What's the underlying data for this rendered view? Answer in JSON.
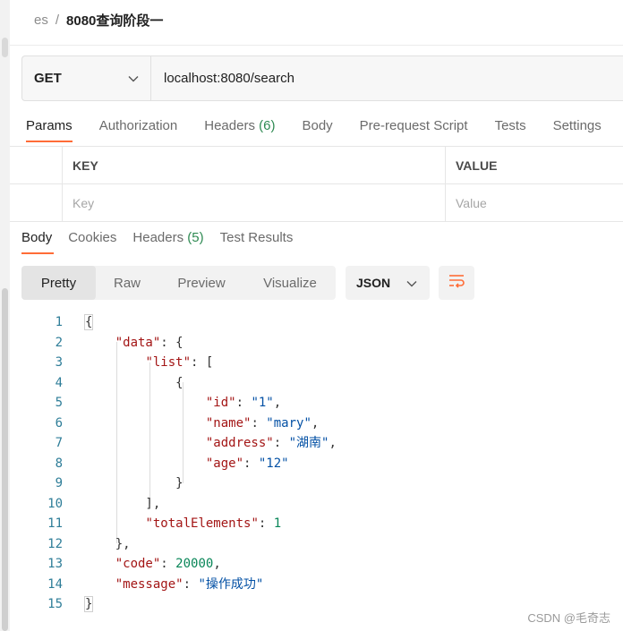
{
  "breadcrumb": {
    "parent": "es",
    "separator": "/",
    "current": "8080查询阶段一"
  },
  "request": {
    "method": "GET",
    "url": "localhost:8080/search"
  },
  "request_tabs": [
    {
      "label": "Params",
      "count": ""
    },
    {
      "label": "Authorization",
      "count": ""
    },
    {
      "label": "Headers",
      "count": "(6)"
    },
    {
      "label": "Body",
      "count": ""
    },
    {
      "label": "Pre-request Script",
      "count": ""
    },
    {
      "label": "Tests",
      "count": ""
    },
    {
      "label": "Settings",
      "count": ""
    }
  ],
  "params_table": {
    "headers": {
      "key": "KEY",
      "value": "VALUE"
    },
    "placeholders": {
      "key": "Key",
      "value": "Value"
    }
  },
  "response_tabs": [
    {
      "label": "Body",
      "count": ""
    },
    {
      "label": "Cookies",
      "count": ""
    },
    {
      "label": "Headers",
      "count": "(5)"
    },
    {
      "label": "Test Results",
      "count": ""
    }
  ],
  "view_modes": [
    "Pretty",
    "Raw",
    "Preview",
    "Visualize"
  ],
  "format": "JSON",
  "icons": {
    "dropdown": "chevron-down-icon",
    "wrap": "wrap-lines-icon"
  },
  "colors": {
    "accent": "#ff6c37",
    "count": "#2e8a52"
  },
  "code_lines": [
    "{",
    "    \"data\": {",
    "        \"list\": [",
    "            {",
    "                \"id\": \"1\",",
    "                \"name\": \"mary\",",
    "                \"address\": \"湖南\",",
    "                \"age\": \"12\"",
    "            }",
    "        ],",
    "        \"totalElements\": 1",
    "    },",
    "    \"code\": 20000,",
    "    \"message\": \"操作成功\"",
    "}"
  ],
  "watermark": "CSDN @毛奇志"
}
